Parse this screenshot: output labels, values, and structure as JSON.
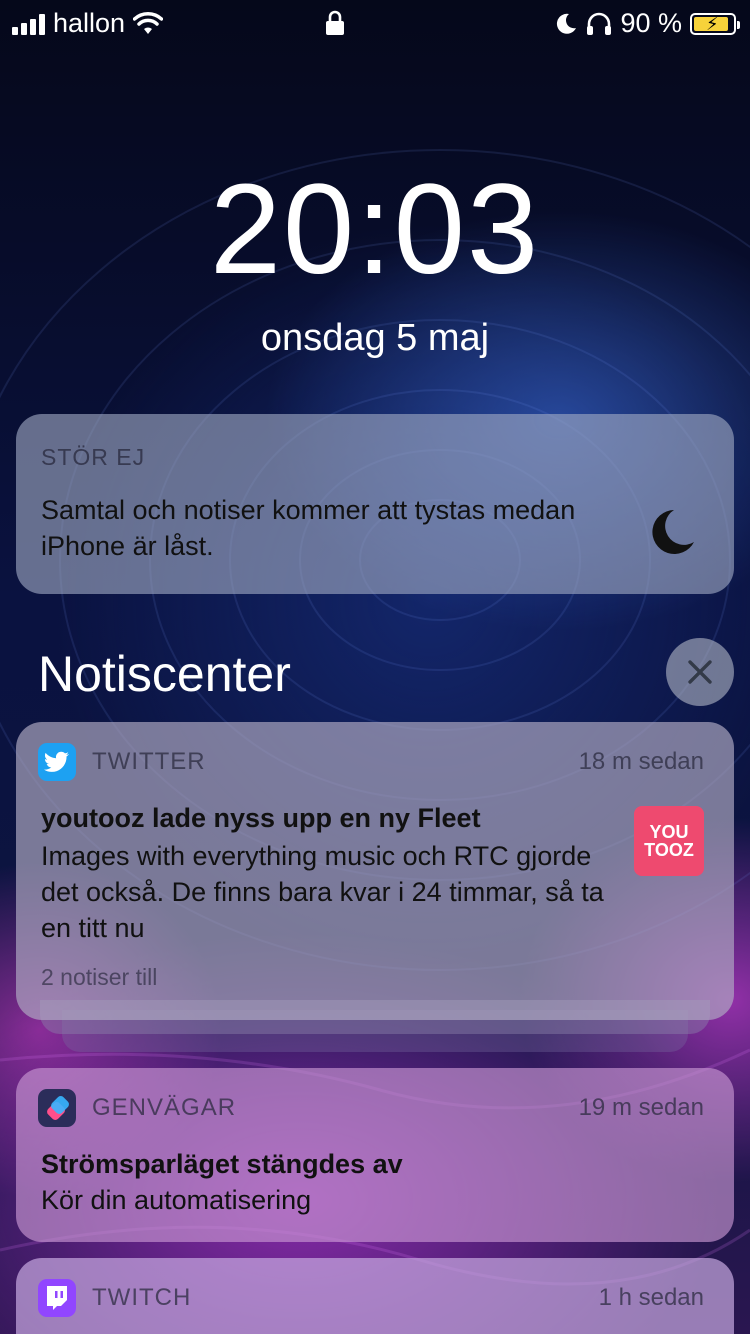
{
  "status_bar": {
    "carrier": "hallon",
    "battery_percent": "90 %",
    "battery_level": 0.9
  },
  "lock_screen": {
    "time": "20:03",
    "date": "onsdag 5 maj"
  },
  "dnd_card": {
    "title": "STÖR EJ",
    "body": "Samtal och notiser kommer att tystas medan iPhone är låst."
  },
  "notification_center": {
    "title": "Notiscenter"
  },
  "notifications": [
    {
      "app": "TWITTER",
      "time": "18 m sedan",
      "title": "youtooz lade nyss upp en ny Fleet",
      "body": "Images with everything music och RTC gjorde det också.  De finns bara kvar i 24 timmar, så ta en titt nu",
      "more": "2 notiser till",
      "thumbnail_text": [
        "YOU",
        "TOOZ"
      ],
      "icon": "twitter-icon",
      "color": "#1da1f2"
    },
    {
      "app": "GENVÄGAR",
      "time": "19 m sedan",
      "title": "Strömsparläget stängdes av",
      "body": "Kör din automatisering",
      "icon": "shortcuts-icon",
      "color": "#2b2d5a"
    },
    {
      "app": "TWITCH",
      "time": "1 h sedan",
      "icon": "twitch-icon",
      "color": "#9146ff"
    }
  ]
}
